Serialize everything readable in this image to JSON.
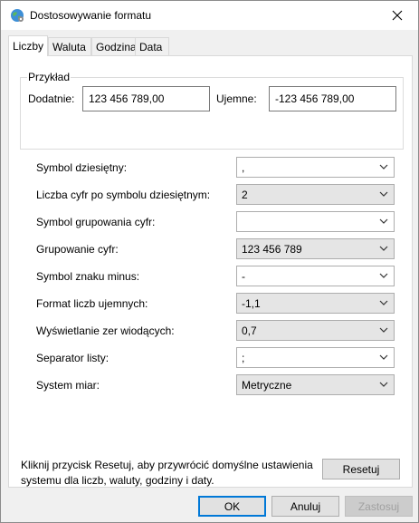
{
  "window": {
    "title": "Dostosowywanie formatu",
    "icon": "globe-settings-icon",
    "close_icon": "close-icon"
  },
  "tabs": [
    {
      "label": "Liczby",
      "active": true
    },
    {
      "label": "Waluta",
      "active": false
    },
    {
      "label": "Godzina",
      "active": false
    },
    {
      "label": "Data",
      "active": false
    }
  ],
  "example": {
    "group_label": "Przykład",
    "positive_label": "Dodatnie:",
    "positive_value": "123 456 789,00",
    "negative_label": "Ujemne:",
    "negative_value": "-123 456 789,00"
  },
  "settings": [
    {
      "label": "Symbol dziesiętny:",
      "value": ",",
      "editable": true
    },
    {
      "label": "Liczba cyfr po symbolu dziesiętnym:",
      "value": "2",
      "editable": false
    },
    {
      "label": "Symbol grupowania cyfr:",
      "value": "",
      "editable": true
    },
    {
      "label": "Grupowanie cyfr:",
      "value": "123 456 789",
      "editable": false
    },
    {
      "label": "Symbol znaku minus:",
      "value": "-",
      "editable": true
    },
    {
      "label": "Format liczb ujemnych:",
      "value": "-1,1",
      "editable": false
    },
    {
      "label": "Wyświetlanie zer wiodących:",
      "value": "0,7",
      "editable": false
    },
    {
      "label": "Separator listy:",
      "value": ";",
      "editable": true
    },
    {
      "label": "System miar:",
      "value": "Metryczne",
      "editable": false
    }
  ],
  "footer": {
    "note": "Kliknij przycisk Resetuj, aby przywrócić domyślne ustawienia systemu dla liczb, waluty, godziny i daty.",
    "reset_label": "Resetuj",
    "ok_label": "OK",
    "cancel_label": "Anuluj",
    "apply_label": "Zastosuj"
  },
  "colors": {
    "accent": "#0078d7",
    "window_bg": "#f0f0f0",
    "readonly_combo": "#e5e5e5"
  }
}
